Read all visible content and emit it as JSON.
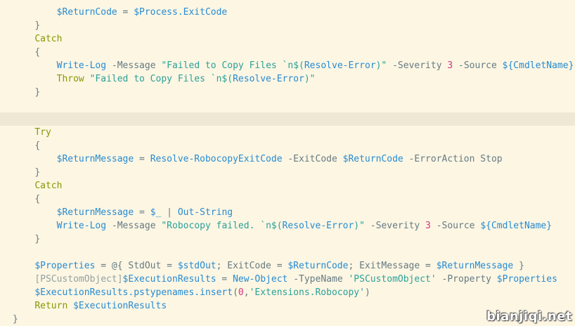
{
  "editor": {
    "current_line": 8,
    "lines": [
      {
        "indent": 8,
        "tokens": [
          {
            "t": "$ReturnCode",
            "c": "var"
          },
          {
            "t": " = ",
            "c": "op"
          },
          {
            "t": "$Process.ExitCode",
            "c": "var"
          }
        ]
      },
      {
        "indent": 4,
        "tokens": [
          {
            "t": "}",
            "c": "plain"
          }
        ]
      },
      {
        "indent": 4,
        "tokens": [
          {
            "t": "Catch",
            "c": "kw"
          }
        ]
      },
      {
        "indent": 4,
        "tokens": [
          {
            "t": "{",
            "c": "plain"
          }
        ]
      },
      {
        "indent": 8,
        "tokens": [
          {
            "t": "Write-Log",
            "c": "cmd"
          },
          {
            "t": " -Message ",
            "c": "plain"
          },
          {
            "t": "\"Failed to Copy Files `n$(",
            "c": "str"
          },
          {
            "t": "Resolve-Error",
            "c": "cmd"
          },
          {
            "t": ")\"",
            "c": "str"
          },
          {
            "t": " -Severity ",
            "c": "plain"
          },
          {
            "t": "3",
            "c": "num"
          },
          {
            "t": " -Source ",
            "c": "plain"
          },
          {
            "t": "${",
            "c": "var"
          },
          {
            "t": "CmdletName",
            "c": "cmd"
          },
          {
            "t": "}",
            "c": "var"
          }
        ]
      },
      {
        "indent": 8,
        "tokens": [
          {
            "t": "Throw",
            "c": "kw"
          },
          {
            "t": " ",
            "c": "plain"
          },
          {
            "t": "\"Failed to Copy Files `n$(",
            "c": "str"
          },
          {
            "t": "Resolve-Error",
            "c": "cmd"
          },
          {
            "t": ")\"",
            "c": "str"
          }
        ]
      },
      {
        "indent": 4,
        "tokens": [
          {
            "t": "}",
            "c": "plain"
          }
        ]
      },
      {
        "indent": 0,
        "tokens": []
      },
      {
        "indent": 0,
        "tokens": []
      },
      {
        "indent": 4,
        "tokens": [
          {
            "t": "Try",
            "c": "kw"
          }
        ]
      },
      {
        "indent": 4,
        "tokens": [
          {
            "t": "{",
            "c": "plain"
          }
        ]
      },
      {
        "indent": 8,
        "tokens": [
          {
            "t": "$ReturnMessage",
            "c": "var"
          },
          {
            "t": " = ",
            "c": "op"
          },
          {
            "t": "Resolve-RobocopyExitCode",
            "c": "cmd"
          },
          {
            "t": " -ExitCode ",
            "c": "plain"
          },
          {
            "t": "$ReturnCode",
            "c": "var"
          },
          {
            "t": " -ErrorAction Stop",
            "c": "plain"
          }
        ]
      },
      {
        "indent": 4,
        "tokens": [
          {
            "t": "}",
            "c": "plain"
          }
        ]
      },
      {
        "indent": 4,
        "tokens": [
          {
            "t": "Catch",
            "c": "kw"
          }
        ]
      },
      {
        "indent": 4,
        "tokens": [
          {
            "t": "{",
            "c": "plain"
          }
        ]
      },
      {
        "indent": 8,
        "tokens": [
          {
            "t": "$ReturnMessage",
            "c": "var"
          },
          {
            "t": " = ",
            "c": "op"
          },
          {
            "t": "$_",
            "c": "var"
          },
          {
            "t": " | ",
            "c": "op"
          },
          {
            "t": "Out-String",
            "c": "cmd"
          }
        ]
      },
      {
        "indent": 8,
        "tokens": [
          {
            "t": "Write-Log",
            "c": "cmd"
          },
          {
            "t": " -Message ",
            "c": "plain"
          },
          {
            "t": "\"Robocopy failed. `n$(",
            "c": "str"
          },
          {
            "t": "Resolve-Error",
            "c": "cmd"
          },
          {
            "t": ")\"",
            "c": "str"
          },
          {
            "t": " -Severity ",
            "c": "plain"
          },
          {
            "t": "3",
            "c": "num"
          },
          {
            "t": " -Source ",
            "c": "plain"
          },
          {
            "t": "${",
            "c": "var"
          },
          {
            "t": "CmdletName",
            "c": "cmd"
          },
          {
            "t": "}",
            "c": "var"
          }
        ]
      },
      {
        "indent": 4,
        "tokens": [
          {
            "t": "}",
            "c": "plain"
          }
        ]
      },
      {
        "indent": 0,
        "tokens": []
      },
      {
        "indent": 4,
        "tokens": [
          {
            "t": "$Properties",
            "c": "var"
          },
          {
            "t": " = @{ StdOut = ",
            "c": "plain"
          },
          {
            "t": "$stdOut",
            "c": "var"
          },
          {
            "t": "; ExitCode = ",
            "c": "plain"
          },
          {
            "t": "$ReturnCode",
            "c": "var"
          },
          {
            "t": "; ExitMessage = ",
            "c": "plain"
          },
          {
            "t": "$ReturnMessage",
            "c": "var"
          },
          {
            "t": " }",
            "c": "plain"
          }
        ]
      },
      {
        "indent": 4,
        "tokens": [
          {
            "t": "[PSCustomObject]",
            "c": "type"
          },
          {
            "t": "$ExecutionResults",
            "c": "var"
          },
          {
            "t": " = ",
            "c": "op"
          },
          {
            "t": "New-Object",
            "c": "cmd"
          },
          {
            "t": " -TypeName ",
            "c": "plain"
          },
          {
            "t": "'PSCustomObject'",
            "c": "str"
          },
          {
            "t": " -Property ",
            "c": "plain"
          },
          {
            "t": "$Properties",
            "c": "var"
          }
        ]
      },
      {
        "indent": 4,
        "tokens": [
          {
            "t": "$ExecutionResults.pstypenames.insert",
            "c": "var"
          },
          {
            "t": "(",
            "c": "plain"
          },
          {
            "t": "0",
            "c": "num"
          },
          {
            "t": ",",
            "c": "plain"
          },
          {
            "t": "'Extensions.Robocopy'",
            "c": "str"
          },
          {
            "t": ")",
            "c": "plain"
          }
        ]
      },
      {
        "indent": 4,
        "tokens": [
          {
            "t": "Return",
            "c": "kw"
          },
          {
            "t": " ",
            "c": "plain"
          },
          {
            "t": "$ExecutionResults",
            "c": "var"
          }
        ]
      },
      {
        "indent": 0,
        "tokens": [
          {
            "t": "}",
            "c": "plain"
          }
        ]
      }
    ]
  },
  "watermark": "bianjiqi.net"
}
